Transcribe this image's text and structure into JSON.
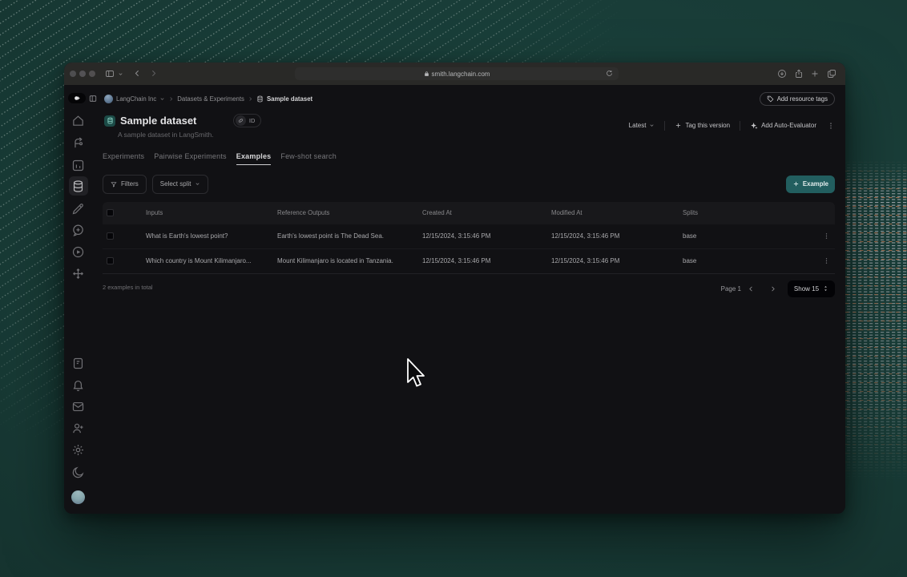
{
  "browser": {
    "url": "smith.langchain.com"
  },
  "breadcrumb": {
    "org": "LangChain Inc",
    "section": "Datasets & Experiments",
    "page": "Sample dataset"
  },
  "header": {
    "title": "Sample dataset",
    "subtitle": "A sample dataset in LangSmith.",
    "id_label": "ID",
    "add_resource_tags": "Add resource tags",
    "version_label": "Latest",
    "tag_version": "Tag this version",
    "add_auto_evaluator": "Add Auto-Evaluator"
  },
  "tabs": [
    {
      "label": "Experiments"
    },
    {
      "label": "Pairwise Experiments"
    },
    {
      "label": "Examples"
    },
    {
      "label": "Few-shot search"
    }
  ],
  "toolbar": {
    "filters": "Filters",
    "select_split": "Select split",
    "add_example": "Example"
  },
  "table": {
    "columns": [
      "Inputs",
      "Reference Outputs",
      "Created At",
      "Modified At",
      "Splits"
    ],
    "rows": [
      {
        "input": "What is Earth's lowest point?",
        "reference_output": "Earth's lowest point is The Dead Sea.",
        "created_at": "12/15/2024, 3:15:46 PM",
        "modified_at": "12/15/2024, 3:15:46 PM",
        "splits": "base"
      },
      {
        "input": "Which country is Mount Kilimanjaro...",
        "reference_output": "Mount Kilimanjaro is located in Tanzania.",
        "created_at": "12/15/2024, 3:15:46 PM",
        "modified_at": "12/15/2024, 3:15:46 PM",
        "splits": "base"
      }
    ]
  },
  "footer": {
    "total": "2 examples in total",
    "page": "Page 1",
    "show": "Show 15"
  },
  "sidebar": {
    "items": [
      "home",
      "projects",
      "monitoring",
      "datasets",
      "annotation-queues",
      "prompts",
      "playground",
      "deployments"
    ],
    "bottom_items": [
      "docs",
      "notifications",
      "mail",
      "invite-user",
      "settings",
      "theme-toggle",
      "user"
    ]
  },
  "colors": {
    "accent_teal": "#225e5f",
    "app_bg": "#111114",
    "chrome_bg": "#292927",
    "desktop_teal": "#183b36"
  }
}
